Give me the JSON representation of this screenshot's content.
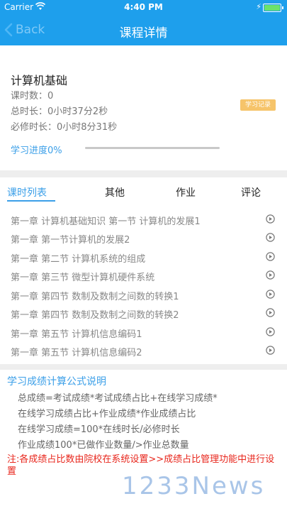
{
  "status": {
    "carrier": "Carrier",
    "time": "4:40 PM"
  },
  "nav": {
    "back": "Back",
    "title": "课程详情"
  },
  "course": {
    "title": "计算机基础",
    "lessons_count": "课时数：0",
    "total_duration": "总时长：0小时37分2秒",
    "required_duration": "必修时长：0小时8分31秒",
    "badge": "学习记录",
    "progress_label": "学习进度0%",
    "progress_value": 0
  },
  "tabs": [
    {
      "label": "课时列表"
    },
    {
      "label": "其他"
    },
    {
      "label": "作业"
    },
    {
      "label": "评论"
    }
  ],
  "lessons": [
    "第一章 计算机基础知识 第一节 计算机的发展1",
    "第一章 第一节计算机的发展2",
    "第一章 第二节 计算机系统的组成",
    "第一章 第三节 微型计算机硬件系统",
    "第一章 第四节 数制及数制之间数的转换1",
    "第一章 第四节 数制及数制之间数的转换2",
    "第一章 第五节 计算机信息编码1",
    "第一章 第五节 计算机信息编码2"
  ],
  "formula": {
    "title": "学习成绩计算公式说明",
    "lines": [
      "总成绩=考试成绩*考试成绩占比+在线学习成绩*",
      "在线学习成绩占比+作业成绩*作业成绩占比",
      "在线学习成绩=100*在线时长/必修时长",
      "作业成绩100*已做作业数量/>作业总数量"
    ],
    "note": "注:各成绩占比数由院校在系统设置>>成绩占比管理功能中进行设置"
  },
  "watermark": "1233News",
  "colors": {
    "accent": "#1e9fec",
    "link": "#3b9fe8",
    "warn": "#e8261c",
    "badge": "#f6c46a"
  }
}
